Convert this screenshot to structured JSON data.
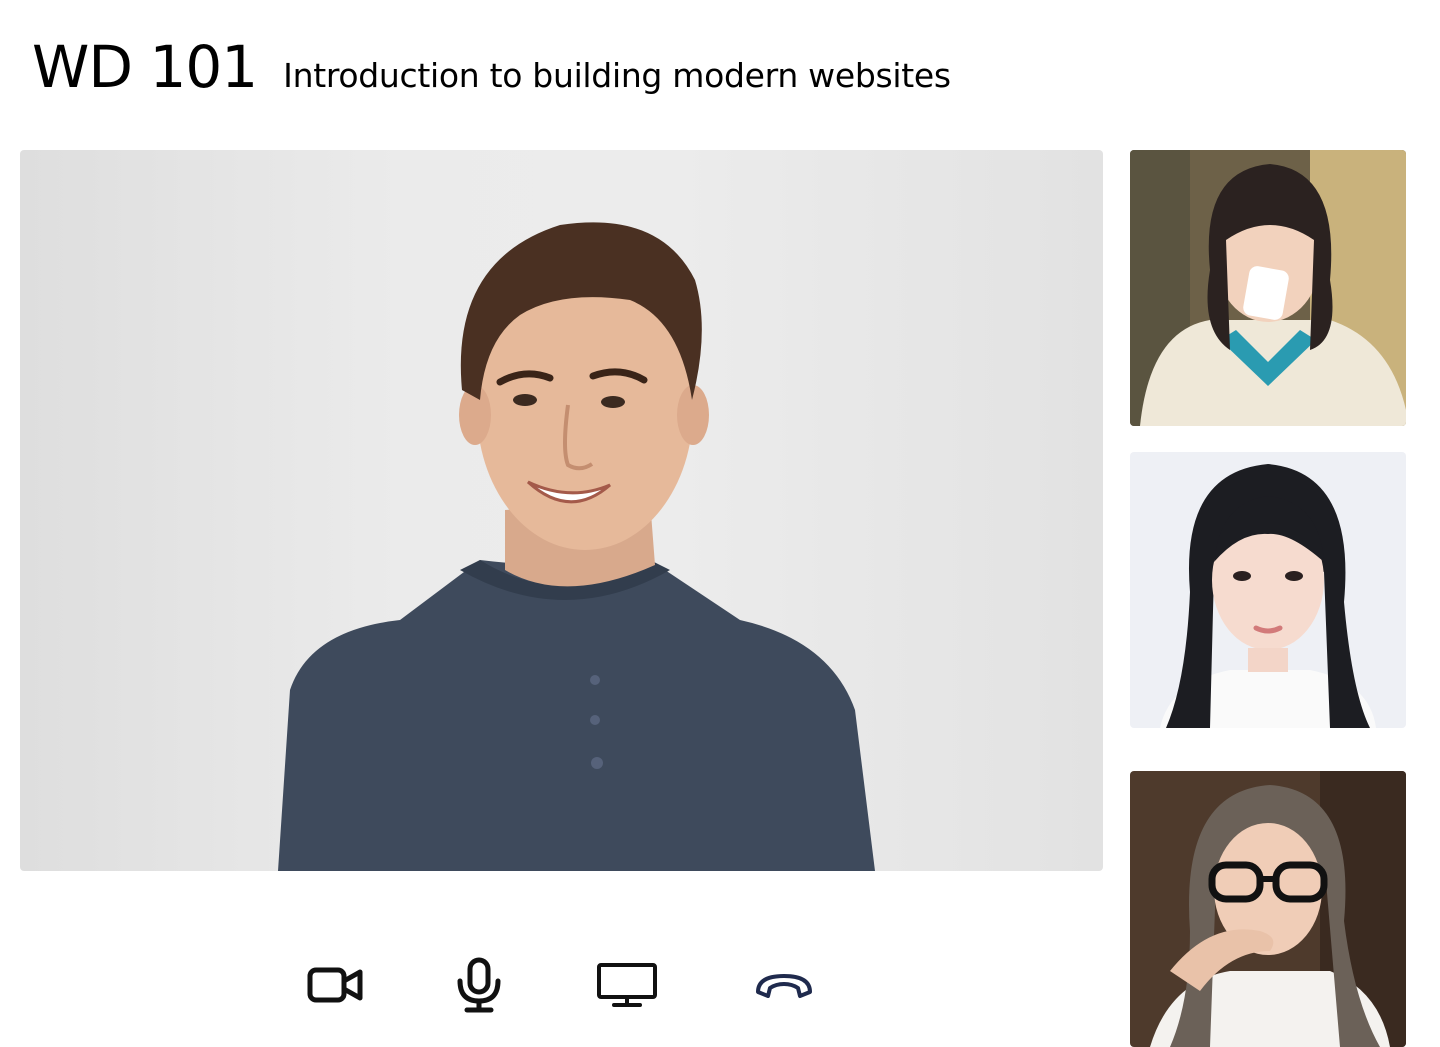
{
  "header": {
    "course_code": "WD 101",
    "course_title": "Introduction to building modern websites"
  },
  "main_video": {
    "participant": "host"
  },
  "participants": [
    {
      "id": "participant-1"
    },
    {
      "id": "participant-2"
    },
    {
      "id": "participant-3"
    }
  ],
  "controls": {
    "camera_icon": "video-camera-icon",
    "mic_icon": "microphone-icon",
    "screen_icon": "monitor-icon",
    "hangup_icon": "phone-hangup-icon"
  },
  "colors": {
    "background": "#ffffff",
    "text": "#000000",
    "icon": "#111111",
    "hangup": "#1f2a4d"
  }
}
